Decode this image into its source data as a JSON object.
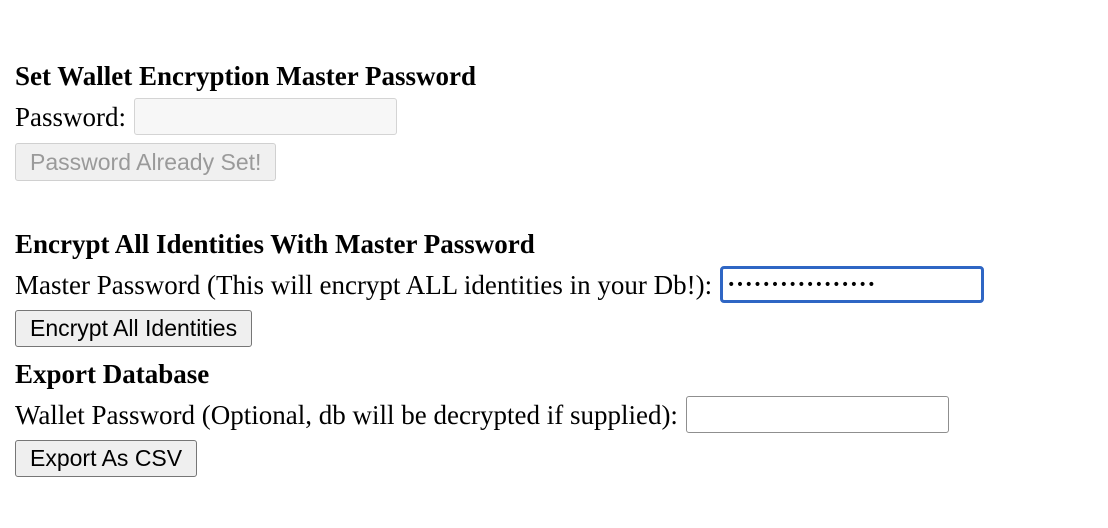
{
  "set_password": {
    "heading": "Set Wallet Encryption Master Password",
    "password_label": "Password:",
    "password_value": "",
    "button_label": "Password Already Set!"
  },
  "encrypt_all": {
    "heading": "Encrypt All Identities With Master Password",
    "master_label": "Master Password (This will encrypt ALL identities in your Db!):",
    "master_value": "•••••••••••••••••",
    "button_label": "Encrypt All Identities"
  },
  "export_db": {
    "heading": "Export Database",
    "wallet_label": "Wallet Password (Optional, db will be decrypted if supplied):",
    "wallet_value": "",
    "button_label": "Export As CSV"
  }
}
